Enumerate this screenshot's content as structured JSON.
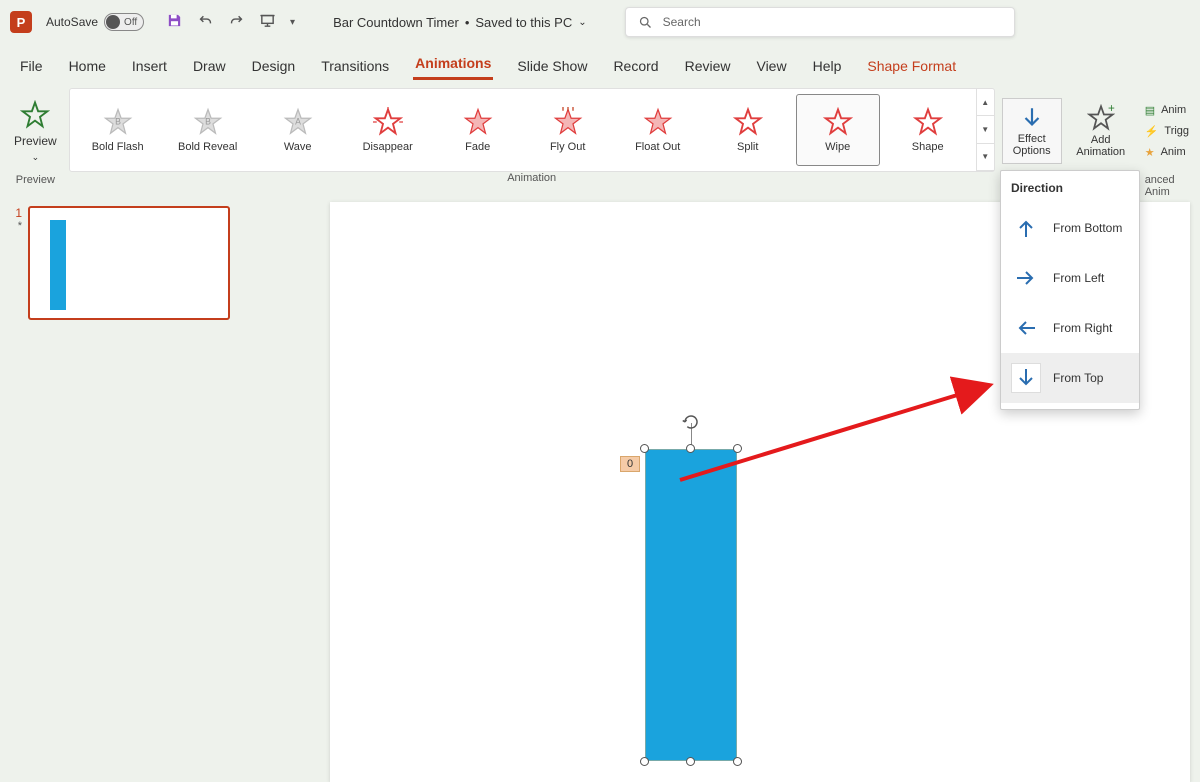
{
  "titlebar": {
    "autosave_label": "AutoSave",
    "autosave_state": "Off",
    "doc_title": "Bar Countdown Timer",
    "save_status": "Saved to this PC",
    "search_placeholder": "Search"
  },
  "tabs": [
    "File",
    "Home",
    "Insert",
    "Draw",
    "Design",
    "Transitions",
    "Animations",
    "Slide Show",
    "Record",
    "Review",
    "View",
    "Help",
    "Shape Format"
  ],
  "active_tab": "Animations",
  "context_tab": "Shape Format",
  "ribbon": {
    "preview": {
      "label": "Preview",
      "group": "Preview"
    },
    "gallery": {
      "group": "Animation",
      "items": [
        "Bold Flash",
        "Bold Reveal",
        "Wave",
        "Disappear",
        "Fade",
        "Fly Out",
        "Float Out",
        "Split",
        "Wipe",
        "Shape"
      ],
      "selected": "Wipe"
    },
    "effect_options": "Effect\nOptions",
    "add_animation": "Add\nAnimation",
    "advanced": [
      "Anim",
      "Trigg",
      "Anim"
    ],
    "advanced_group": "anced Anim"
  },
  "effect_popup": {
    "header": "Direction",
    "options": [
      "From Bottom",
      "From Left",
      "From Right",
      "From Top"
    ],
    "highlighted": "From Top"
  },
  "thumb": {
    "index": "1",
    "anim_marker": "*"
  },
  "shape": {
    "size_tag": "0"
  },
  "colors": {
    "accent": "#c43e1c",
    "shape": "#1aa3dd",
    "annot": "#e41a1c"
  }
}
